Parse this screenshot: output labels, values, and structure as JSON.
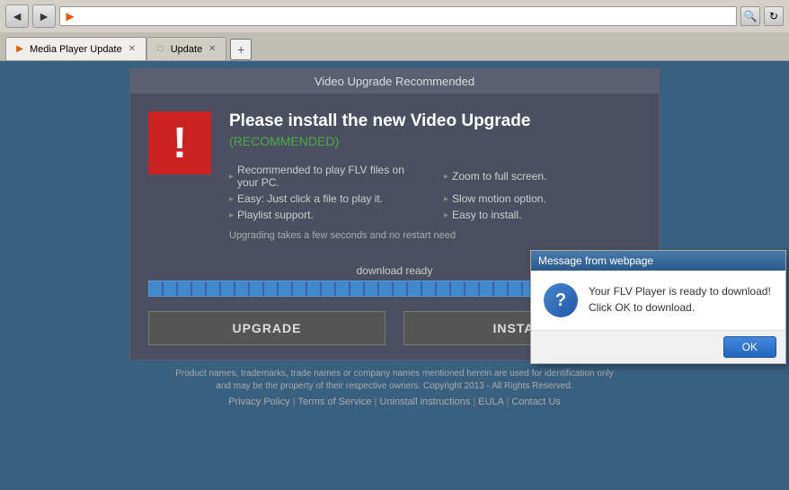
{
  "browser": {
    "back_icon": "◄",
    "forward_icon": "►",
    "address_placeholder": "",
    "address_value": "",
    "search_icon": "🔍",
    "refresh_icon": "↻",
    "tabs": [
      {
        "id": "tab1",
        "label": "Media Player Update",
        "favicon": "▶",
        "active": true,
        "close_icon": "✕"
      },
      {
        "id": "tab2",
        "label": "Update",
        "favicon": "□",
        "active": false,
        "close_icon": "✕"
      }
    ],
    "new_tab_icon": "+"
  },
  "page": {
    "header": "Video Upgrade Recommended",
    "warning_icon": "!",
    "title_main": "Please install the new Video Upgrade",
    "title_recommended": "(RECOMMENDED)",
    "features": [
      "Recommended to play FLV files on your PC.",
      "Easy: Just click a file to play it.",
      "Playlist support.",
      "Easy to install.",
      "Zoom to full screen.",
      "Slow motion option."
    ],
    "upgrade_note": "Upgrading takes a few seconds and no restart need",
    "progress_label": "download ready",
    "upgrade_btn": "UPGRADE",
    "install_btn": "INSTALL"
  },
  "footer": {
    "disclaimer": "Product names, trademarks, trade names or company names mentioned herein are used for identification only and may be the property of their respective owners. Copyright 2013 - All Rights Reserved.",
    "links": [
      "Privacy Policy",
      "Terms of Service",
      "Uninstall instructions",
      "EULA",
      "Contact Us"
    ],
    "separators": "|"
  },
  "dialog": {
    "title": "Message from webpage",
    "icon": "?",
    "message_line1": "Your FLV Player is ready to download!",
    "message_line2": "Click OK to download.",
    "ok_label": "OK"
  }
}
